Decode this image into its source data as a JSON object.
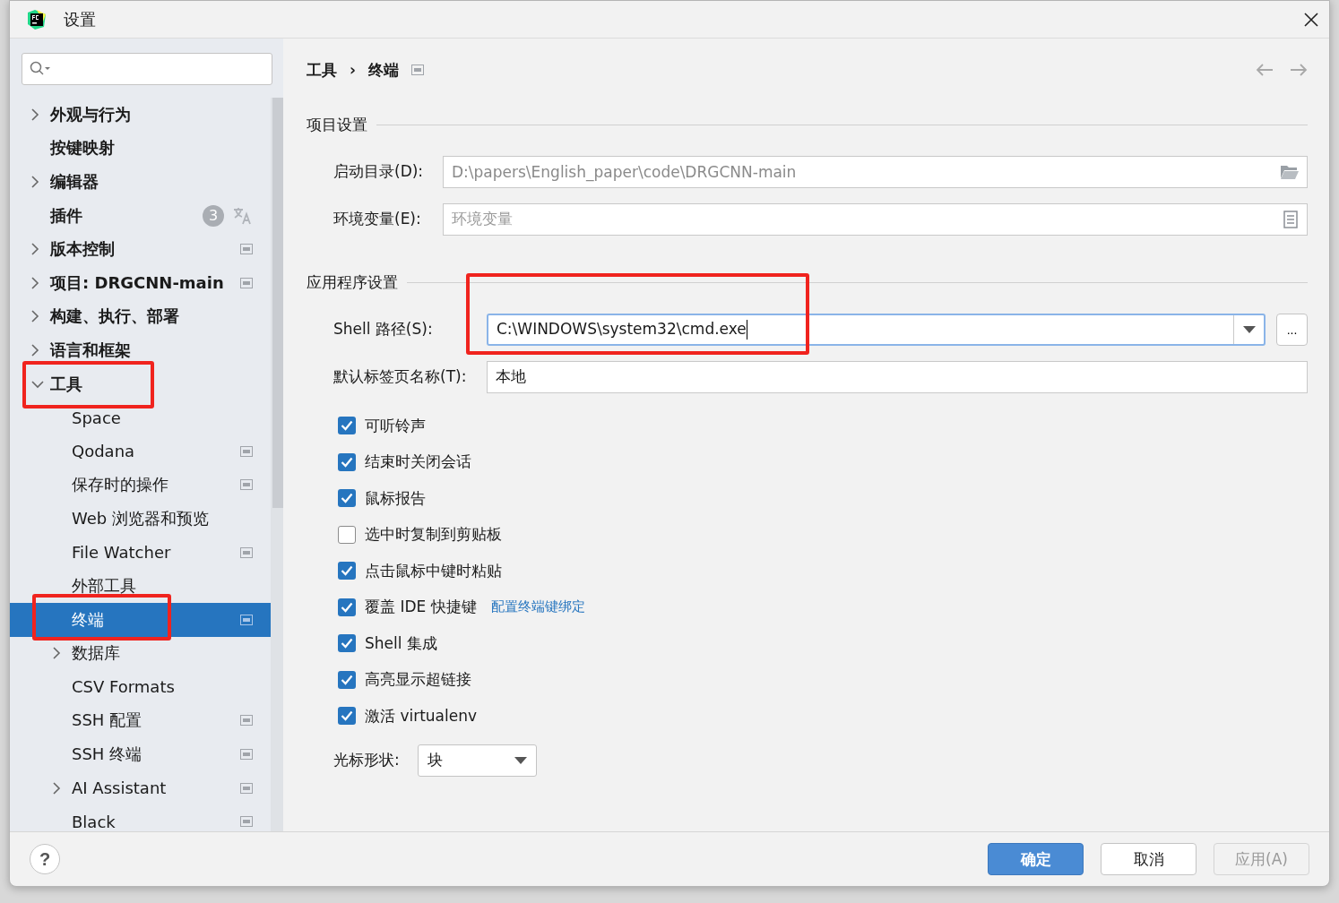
{
  "window": {
    "title": "设置"
  },
  "sidebar": {
    "tree": [
      {
        "label": "外观与行为",
        "expandable": true,
        "expanded": false,
        "selected": false,
        "project_icon": false
      },
      {
        "label": "按键映射",
        "expandable": false,
        "selected": false,
        "project_icon": false
      },
      {
        "label": "编辑器",
        "expandable": true,
        "expanded": false,
        "selected": false,
        "project_icon": false
      },
      {
        "label": "插件",
        "expandable": false,
        "selected": false,
        "project_icon": false,
        "badge": "3"
      },
      {
        "label": "版本控制",
        "expandable": true,
        "expanded": false,
        "selected": false,
        "project_icon": true
      },
      {
        "label": "项目: DRGCNN-main",
        "expandable": true,
        "expanded": false,
        "selected": false,
        "project_icon": true
      },
      {
        "label": "构建、执行、部署",
        "expandable": true,
        "expanded": false,
        "selected": false,
        "project_icon": false
      },
      {
        "label": "语言和框架",
        "expandable": true,
        "expanded": false,
        "selected": false,
        "project_icon": false
      },
      {
        "label": "工具",
        "expandable": true,
        "expanded": true,
        "selected": false,
        "project_icon": false,
        "children": [
          {
            "label": "Space",
            "expandable": false,
            "selected": false,
            "project_icon": false
          },
          {
            "label": "Qodana",
            "expandable": false,
            "selected": false,
            "project_icon": true
          },
          {
            "label": "保存时的操作",
            "expandable": false,
            "selected": false,
            "project_icon": true
          },
          {
            "label": "Web 浏览器和预览",
            "expandable": false,
            "selected": false,
            "project_icon": false
          },
          {
            "label": "File Watcher",
            "expandable": false,
            "selected": false,
            "project_icon": true
          },
          {
            "label": "外部工具",
            "expandable": false,
            "selected": false,
            "project_icon": false
          },
          {
            "label": "终端",
            "expandable": false,
            "selected": true,
            "project_icon": true
          },
          {
            "label": "数据库",
            "expandable": true,
            "expanded": false,
            "selected": false,
            "project_icon": false
          },
          {
            "label": "CSV Formats",
            "expandable": false,
            "selected": false,
            "project_icon": false
          },
          {
            "label": "SSH 配置",
            "expandable": false,
            "selected": false,
            "project_icon": true
          },
          {
            "label": "SSH 终端",
            "expandable": false,
            "selected": false,
            "project_icon": true
          },
          {
            "label": "AI Assistant",
            "expandable": true,
            "expanded": false,
            "selected": false,
            "project_icon": true
          },
          {
            "label": "Black",
            "expandable": false,
            "selected": false,
            "project_icon": true
          }
        ]
      }
    ]
  },
  "breadcrumb": [
    "工具",
    "终端"
  ],
  "breadcrumb_separator": "›",
  "project_section": {
    "title": "项目设置",
    "fields": [
      {
        "label": "启动目录(D):",
        "value": "D:\\papers\\English_paper\\code\\DRGCNN-main",
        "kind": "folder"
      },
      {
        "label": "环境变量(E):",
        "placeholder": "环境变量",
        "kind": "document"
      }
    ]
  },
  "app_section": {
    "title": "应用程序设置",
    "shell_path": {
      "label": "Shell 路径(S):",
      "value": "C:\\WINDOWS\\system32\\cmd.exe",
      "browse": "..."
    },
    "tab_name": {
      "label": "默认标签页名称(T):",
      "value": "本地"
    },
    "checkboxes": [
      {
        "label": "可听铃声",
        "checked": true
      },
      {
        "label": "结束时关闭会话",
        "checked": true
      },
      {
        "label": "鼠标报告",
        "checked": true
      },
      {
        "label": "选中时复制到剪贴板",
        "checked": false
      },
      {
        "label": "点击鼠标中键时粘贴",
        "checked": true
      },
      {
        "label": "覆盖 IDE 快捷键",
        "checked": true,
        "link": "配置终端键绑定"
      },
      {
        "label": "Shell 集成",
        "checked": true
      },
      {
        "label": "高亮显示超链接",
        "checked": true
      },
      {
        "label": "激活 virtualenv",
        "checked": true
      }
    ],
    "cursor_shape": {
      "label": "光标形状:",
      "value": "块"
    }
  },
  "footer": {
    "help": "?",
    "buttons": [
      {
        "label": "确定",
        "kind": "primary",
        "disabled": false
      },
      {
        "label": "取消",
        "kind": "normal",
        "disabled": false
      },
      {
        "label": "应用(A)",
        "kind": "normal",
        "disabled": true
      }
    ]
  }
}
